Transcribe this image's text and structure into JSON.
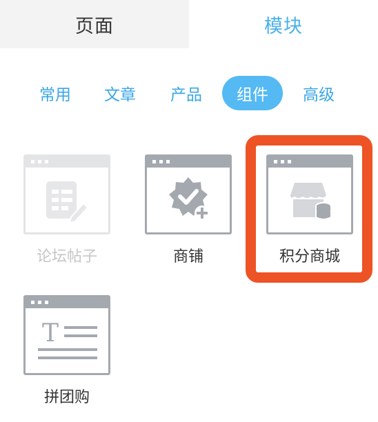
{
  "top_tabs": [
    {
      "label": "页面",
      "active": false
    },
    {
      "label": "模块",
      "active": true
    }
  ],
  "sub_tabs": [
    {
      "label": "常用",
      "selected": false
    },
    {
      "label": "文章",
      "selected": false
    },
    {
      "label": "产品",
      "selected": false
    },
    {
      "label": "组件",
      "selected": true
    },
    {
      "label": "高级",
      "selected": false
    }
  ],
  "modules": [
    {
      "label": "论坛帖子",
      "icon": "forum-post-icon",
      "disabled": true
    },
    {
      "label": "商铺",
      "icon": "verified-badge-plus-icon",
      "disabled": false
    },
    {
      "label": "积分商城",
      "icon": "store-coins-icon",
      "disabled": false,
      "highlighted": true
    },
    {
      "label": "拼团购",
      "icon": "text-document-icon",
      "disabled": false
    }
  ],
  "colors": {
    "accent": "#4ab0ea",
    "selected_pill": "#55b9f3",
    "highlight_border": "#ee5325",
    "icon_gray": "#a4a9b0",
    "disabled_gray": "#e3e4e6"
  }
}
